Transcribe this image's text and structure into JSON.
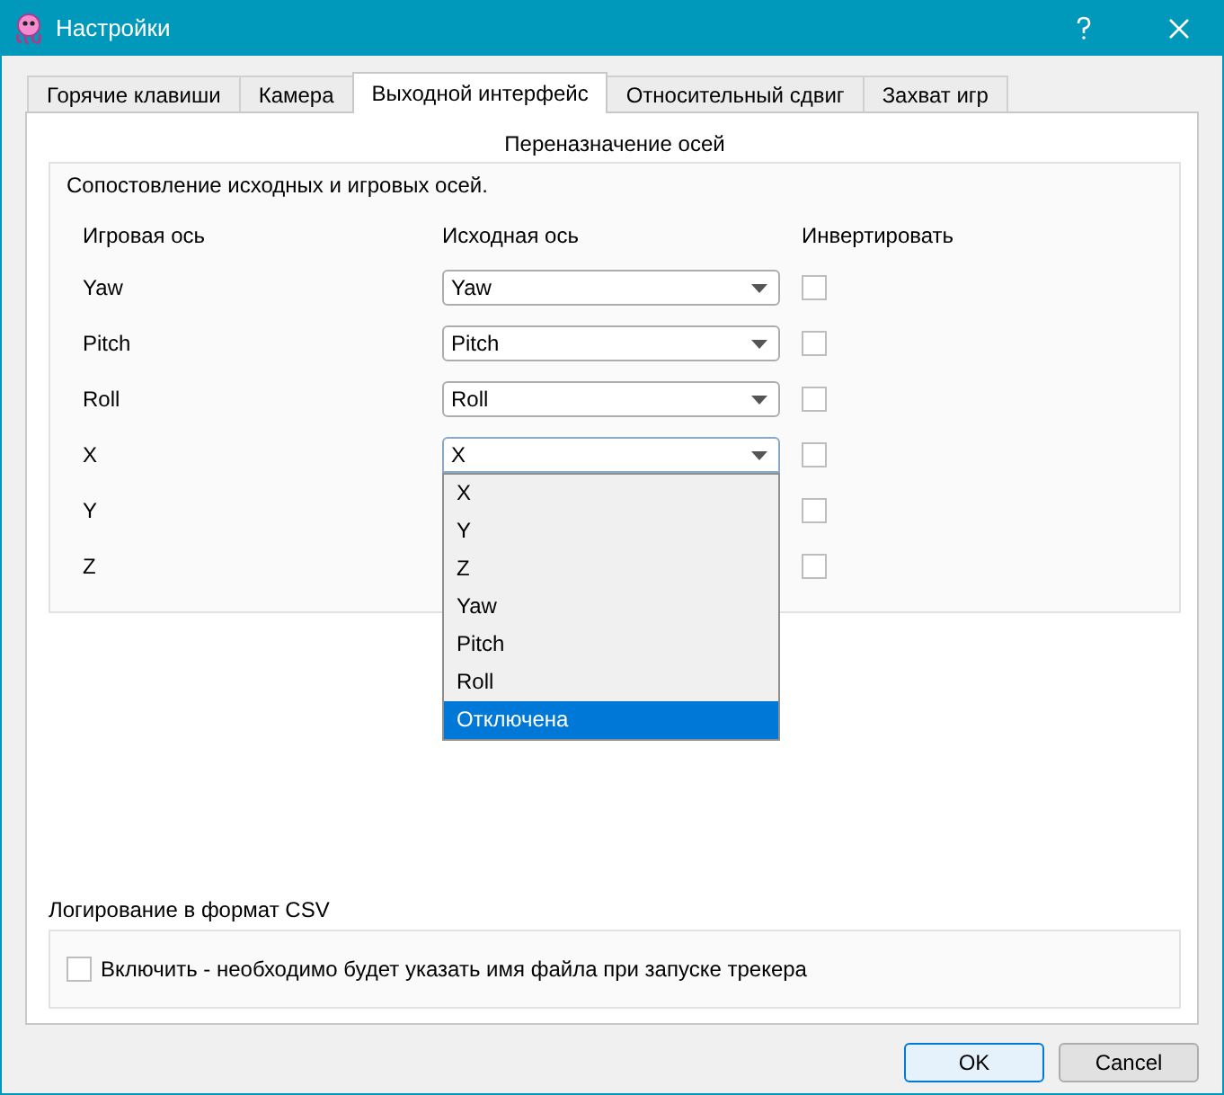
{
  "window": {
    "title": "Настройки"
  },
  "tabs": [
    {
      "label": "Горячие клавиши",
      "selected": false
    },
    {
      "label": "Камера",
      "selected": false
    },
    {
      "label": "Выходной интерфейс",
      "selected": true
    },
    {
      "label": "Относительный сдвиг",
      "selected": false
    },
    {
      "label": "Захват игр",
      "selected": false
    }
  ],
  "axis_mapping": {
    "title": "Переназначение осей",
    "description": "Сопостовление исходных и игровых осей.",
    "columns": [
      "Игровая ось",
      "Исходная ось",
      "Инвертировать"
    ],
    "rows": [
      {
        "axis": "Yaw",
        "source": "Yaw",
        "inverted": false,
        "dropdown_open": false
      },
      {
        "axis": "Pitch",
        "source": "Pitch",
        "inverted": false,
        "dropdown_open": false
      },
      {
        "axis": "Roll",
        "source": "Roll",
        "inverted": false,
        "dropdown_open": false
      },
      {
        "axis": "X",
        "source": "X",
        "inverted": false,
        "dropdown_open": true
      },
      {
        "axis": "Y",
        "inverted": false
      },
      {
        "axis": "Z",
        "inverted": false
      }
    ],
    "dropdown_options": [
      {
        "label": "X",
        "selected": false
      },
      {
        "label": "Y",
        "selected": false
      },
      {
        "label": "Z",
        "selected": false
      },
      {
        "label": "Yaw",
        "selected": false
      },
      {
        "label": "Pitch",
        "selected": false
      },
      {
        "label": "Roll",
        "selected": false
      },
      {
        "label": "Отключена",
        "selected": true
      }
    ]
  },
  "csv_logging": {
    "title": "Логирование в формат CSV",
    "checkbox_label": "Включить - необходимо будет указать имя файла при запуске трекера",
    "checked": false
  },
  "buttons": [
    {
      "label": "OK",
      "default": true
    },
    {
      "label": "Cancel",
      "default": false
    }
  ]
}
